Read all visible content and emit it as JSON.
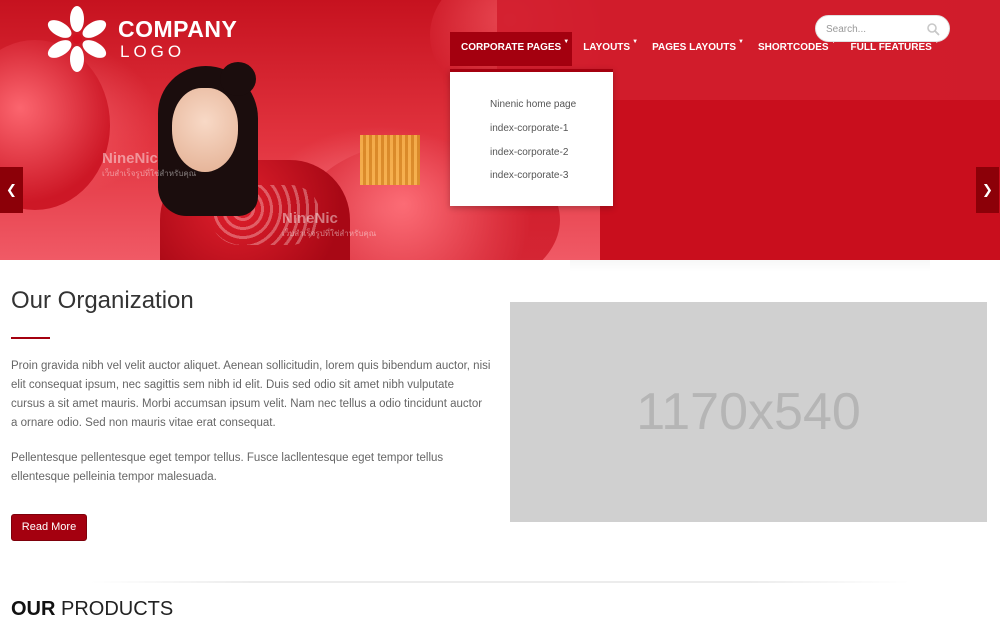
{
  "logo": {
    "title": "COMPANY",
    "subtitle": "LOGO"
  },
  "nav": {
    "items": [
      {
        "label": "CORPORATE PAGES",
        "active": true
      },
      {
        "label": "LAYOUTS",
        "active": false
      },
      {
        "label": "PAGES LAYOUTS",
        "active": false
      },
      {
        "label": "SHORTCODES",
        "active": false
      },
      {
        "label": "FULL FEATURES",
        "active": false
      }
    ],
    "dropdown": [
      "Ninenic home page",
      "index-corporate-1",
      "index-corporate-2",
      "index-corporate-3"
    ]
  },
  "search": {
    "placeholder": "Search..."
  },
  "hero": {
    "watermark_brand": "NineNic",
    "watermark_tagline": "เว็บสำเร็จรูปที่ใช่สำหรับคุณ",
    "prev_icon": "chevron-left-icon",
    "next_icon": "chevron-right-icon"
  },
  "organization": {
    "title": "Our Organization",
    "paragraph1": "Proin gravida nibh vel velit auctor aliquet. Aenean sollicitudin, lorem quis bibendum auctor, nisi elit consequat ipsum, nec sagittis sem nibh id elit. Duis sed odio sit amet nibh vulputate cursus a sit amet mauris. Morbi accumsan ipsum velit. Nam nec tellus a odio tincidunt auctor a ornare odio. Sed non mauris vitae erat consequat.",
    "paragraph2": "Pellentesque pellentesque eget tempor tellus. Fusce lacllentesque eget tempor tellus ellentesque pelleinia tempor malesuada.",
    "button": "Read More",
    "image_label": "1170x540"
  },
  "products": {
    "title_bold": "OUR",
    "title_rest": " PRODUCTS"
  },
  "colors": {
    "brand_red": "#a4000f",
    "hero_red": "#c90e1d"
  }
}
